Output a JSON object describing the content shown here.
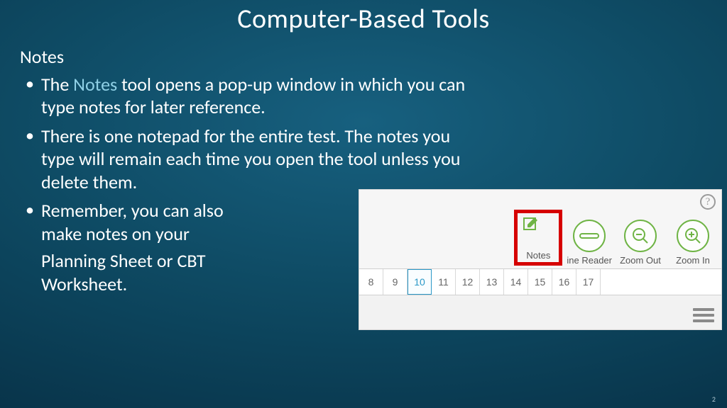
{
  "title": "Computer-Based Tools",
  "section": "Notes",
  "accent_word": "Notes",
  "b1_pre": "The ",
  "b1_post": " tool opens a pop-up window in which you can type notes for later reference.",
  "b2": "There is one notepad for the entire test. The notes you type will remain each time you open the tool unless you delete them.",
  "b3": "Remember, you can also make notes on your",
  "b3_sub": "Planning Sheet or CBT Worksheet.",
  "help": "?",
  "tools": {
    "notes": "Notes",
    "line_reader_partial": "ine Reader",
    "zoom_out": "Zoom Out",
    "zoom_in": "Zoom In"
  },
  "nav": [
    "8",
    "9",
    "10",
    "11",
    "12",
    "13",
    "14",
    "15",
    "16",
    "17"
  ],
  "nav_selected": "10",
  "page_number": "2"
}
